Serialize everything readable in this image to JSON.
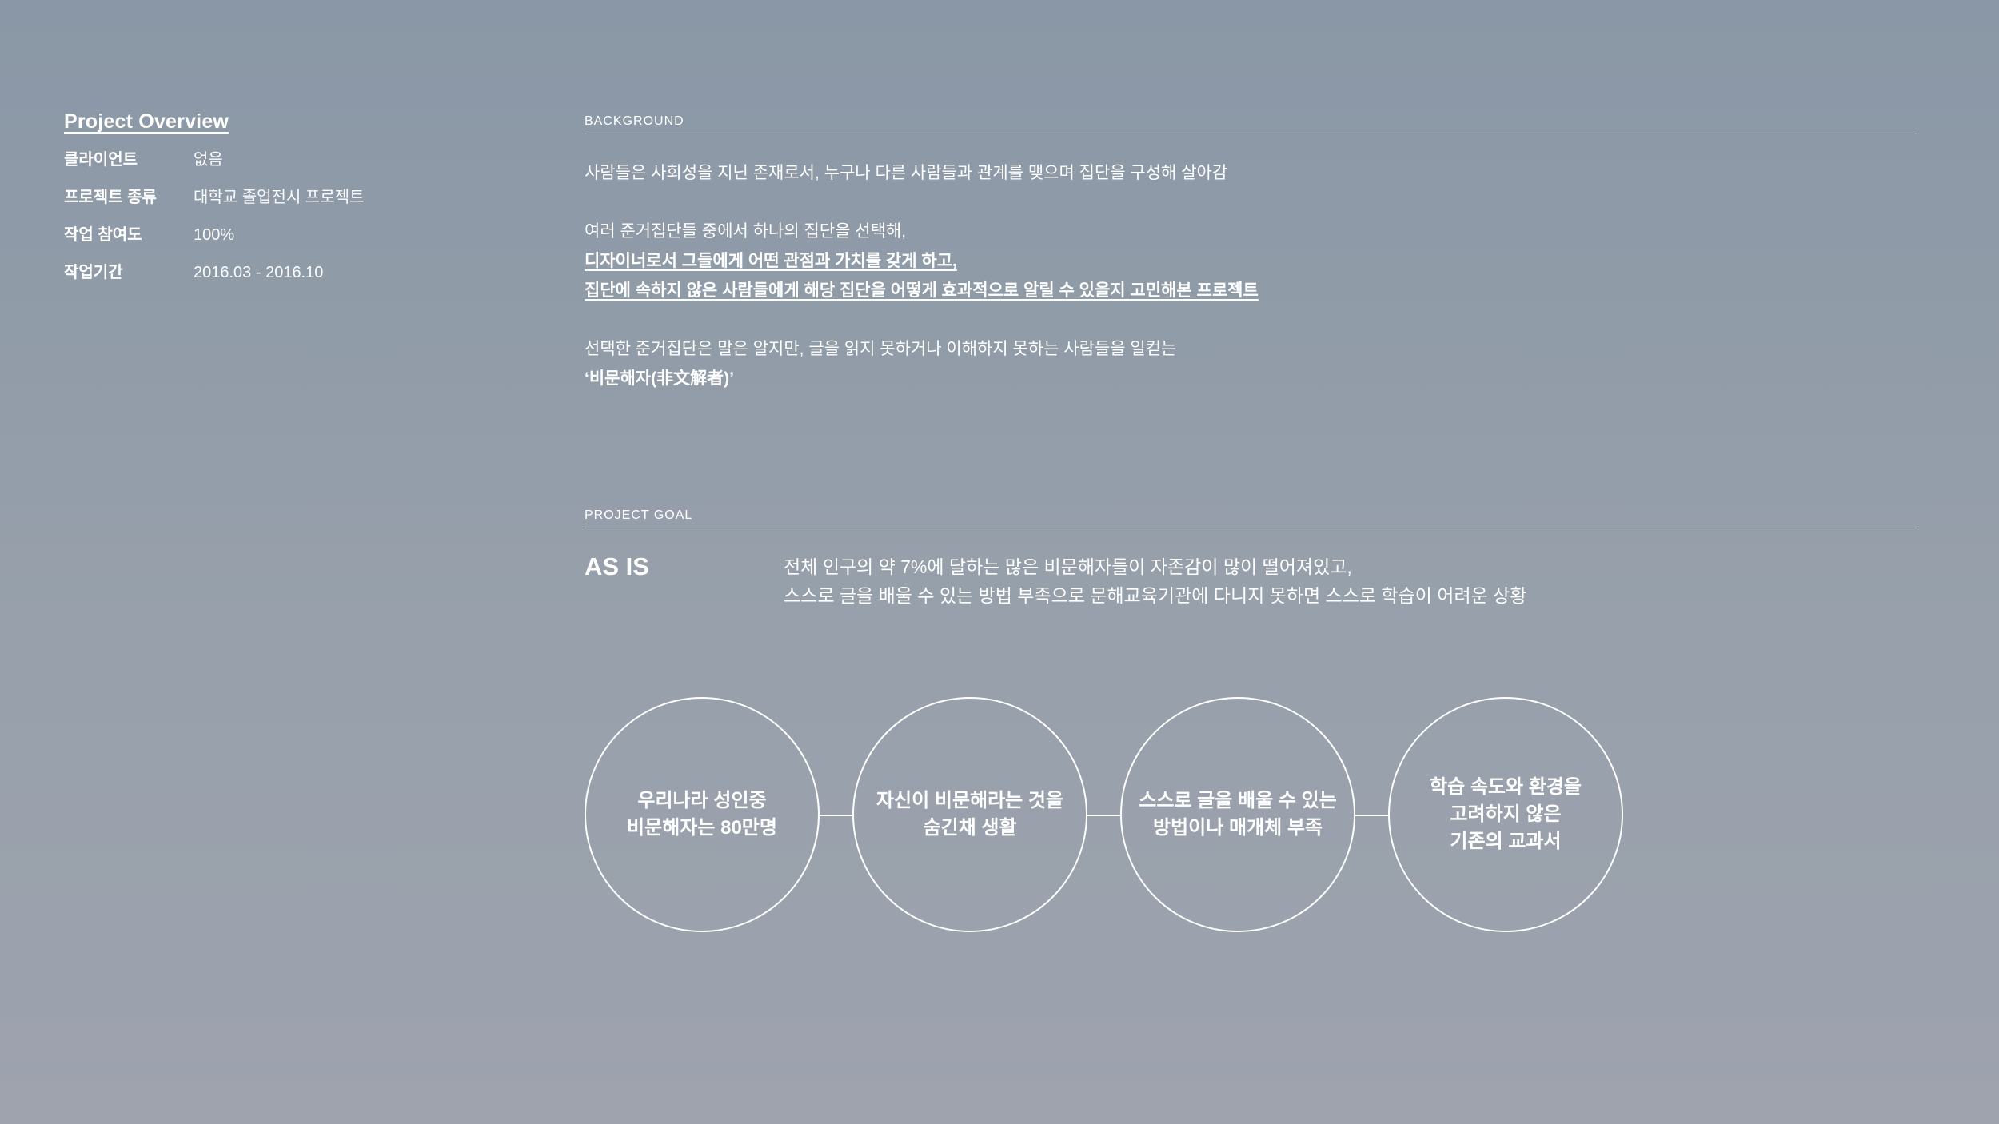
{
  "overview": {
    "title": "Project Overview",
    "rows": [
      {
        "label": "클라이언트",
        "value": "없음"
      },
      {
        "label": "프로젝트 종류",
        "value": "대학교 졸업전시 프로젝트"
      },
      {
        "label": "작업 참여도",
        "value": "100%"
      },
      {
        "label": "작업기간",
        "value": "2016.03 - 2016.10"
      }
    ]
  },
  "background": {
    "heading": "BACKGROUND",
    "line1": "사람들은 사회성을 지닌 존재로서, 누구나 다른 사람들과 관계를 맺으며 집단을 구성해 살아감",
    "line2": "여러 준거집단들 중에서 하나의 집단을 선택해,",
    "line3": "디자이너로서 그들에게 어떤 관점과 가치를 갖게 하고,",
    "line4": "집단에 속하지 않은 사람들에게 해당 집단을 어떻게 효과적으로 알릴 수 있을지 고민해본 프로젝트",
    "line5": "선택한 준거집단은 말은 알지만, 글을 읽지 못하거나 이해하지 못하는 사람들을 일컫는",
    "line6": "‘비문해자(非文解者)’"
  },
  "goal": {
    "heading": "PROJECT GOAL",
    "asis_label": "AS IS",
    "asis_line1": "전체 인구의 약 7%에 달하는 많은 비문해자들이 자존감이 많이 떨어져있고,",
    "asis_line2": "스스로 글을 배울 수 있는 방법 부족으로 문해교육기관에 다니지 못하면 스스로 학습이 어려운 상황",
    "circles": [
      "우리나라 성인중\n비문해자는 80만명",
      "자신이 비문해라는 것을\n숨긴채 생활",
      "스스로 글을 배울 수 있는\n방법이나 매개체 부족",
      "학습 속도와 환경을\n고려하지 않은\n기존의 교과서"
    ]
  }
}
